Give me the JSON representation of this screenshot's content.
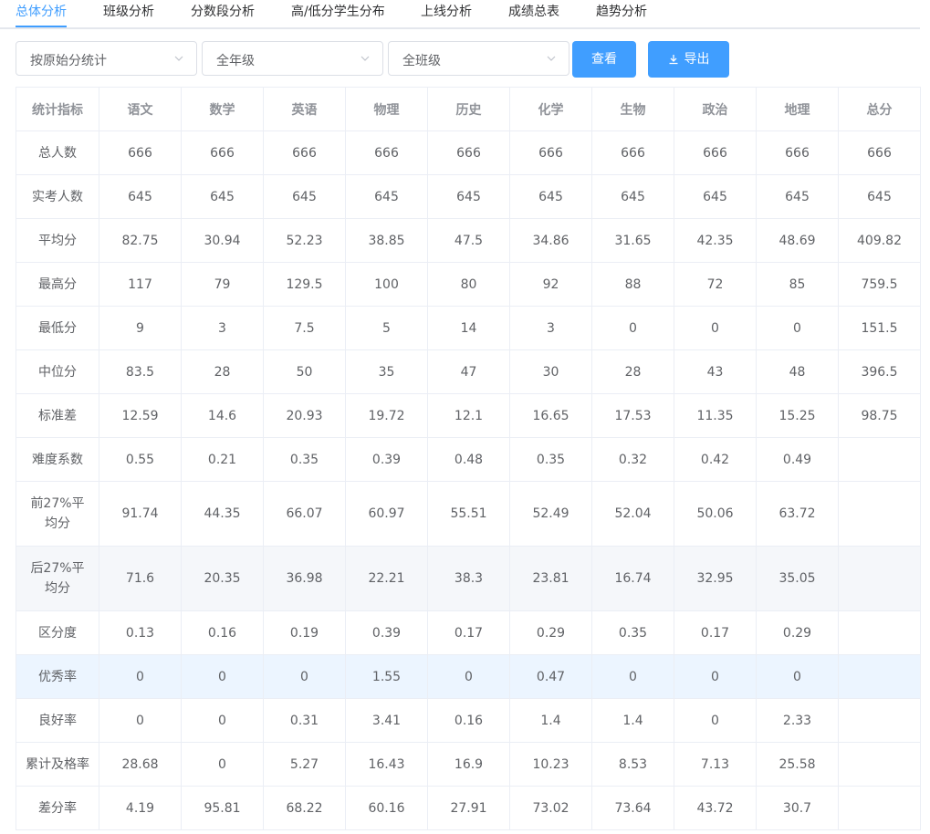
{
  "tabs": [
    {
      "label": "总体分析",
      "active": true
    },
    {
      "label": "班级分析"
    },
    {
      "label": "分数段分析"
    },
    {
      "label": "高/低分学生分布"
    },
    {
      "label": "上线分析"
    },
    {
      "label": "成绩总表"
    },
    {
      "label": "趋势分析"
    }
  ],
  "filters": {
    "mode": "按原始分统计",
    "grade": "全年级",
    "class": "全班级"
  },
  "buttons": {
    "view": "查看",
    "export": "导出"
  },
  "colors": {
    "accent": "#409eff",
    "highlight_row": "#ecf5ff",
    "striped_row": "#f5f7fa"
  },
  "table": {
    "headers": [
      "统计指标",
      "语文",
      "数学",
      "英语",
      "物理",
      "历史",
      "化学",
      "生物",
      "政治",
      "地理",
      "总分"
    ],
    "rows": [
      {
        "label": "总人数",
        "values": [
          "666",
          "666",
          "666",
          "666",
          "666",
          "666",
          "666",
          "666",
          "666",
          "666"
        ]
      },
      {
        "label": "实考人数",
        "values": [
          "645",
          "645",
          "645",
          "645",
          "645",
          "645",
          "645",
          "645",
          "645",
          "645"
        ]
      },
      {
        "label": "平均分",
        "values": [
          "82.75",
          "30.94",
          "52.23",
          "38.85",
          "47.5",
          "34.86",
          "31.65",
          "42.35",
          "48.69",
          "409.82"
        ]
      },
      {
        "label": "最高分",
        "values": [
          "117",
          "79",
          "129.5",
          "100",
          "80",
          "92",
          "88",
          "72",
          "85",
          "759.5"
        ]
      },
      {
        "label": "最低分",
        "values": [
          "9",
          "3",
          "7.5",
          "5",
          "14",
          "3",
          "0",
          "0",
          "0",
          "151.5"
        ]
      },
      {
        "label": "中位分",
        "values": [
          "83.5",
          "28",
          "50",
          "35",
          "47",
          "30",
          "28",
          "43",
          "48",
          "396.5"
        ]
      },
      {
        "label": "标准差",
        "values": [
          "12.59",
          "14.6",
          "20.93",
          "19.72",
          "12.1",
          "16.65",
          "17.53",
          "11.35",
          "15.25",
          "98.75"
        ]
      },
      {
        "label": "难度系数",
        "values": [
          "0.55",
          "0.21",
          "0.35",
          "0.39",
          "0.48",
          "0.35",
          "0.32",
          "0.42",
          "0.49",
          ""
        ]
      },
      {
        "label": "前27%平均分",
        "label_lines": [
          "前27%平",
          "均分"
        ],
        "values": [
          "91.74",
          "44.35",
          "66.07",
          "60.97",
          "55.51",
          "52.49",
          "52.04",
          "50.06",
          "63.72",
          ""
        ],
        "tall": true
      },
      {
        "label": "后27%平均分",
        "label_lines": [
          "后27%平",
          "均分"
        ],
        "values": [
          "71.6",
          "20.35",
          "36.98",
          "22.21",
          "38.3",
          "23.81",
          "16.74",
          "32.95",
          "35.05",
          ""
        ],
        "tall": true,
        "striped": true
      },
      {
        "label": "区分度",
        "values": [
          "0.13",
          "0.16",
          "0.19",
          "0.39",
          "0.17",
          "0.29",
          "0.35",
          "0.17",
          "0.29",
          ""
        ]
      },
      {
        "label": "优秀率",
        "values": [
          "0",
          "0",
          "0",
          "1.55",
          "0",
          "0.47",
          "0",
          "0",
          "0",
          ""
        ],
        "highlight": true
      },
      {
        "label": "良好率",
        "values": [
          "0",
          "0",
          "0.31",
          "3.41",
          "0.16",
          "1.4",
          "1.4",
          "0",
          "2.33",
          ""
        ]
      },
      {
        "label": "累计及格率",
        "values": [
          "28.68",
          "0",
          "5.27",
          "16.43",
          "16.9",
          "10.23",
          "8.53",
          "7.13",
          "25.58",
          ""
        ]
      },
      {
        "label": "差分率",
        "values": [
          "4.19",
          "95.81",
          "68.22",
          "60.16",
          "27.91",
          "73.02",
          "73.64",
          "43.72",
          "30.7",
          ""
        ]
      }
    ]
  }
}
